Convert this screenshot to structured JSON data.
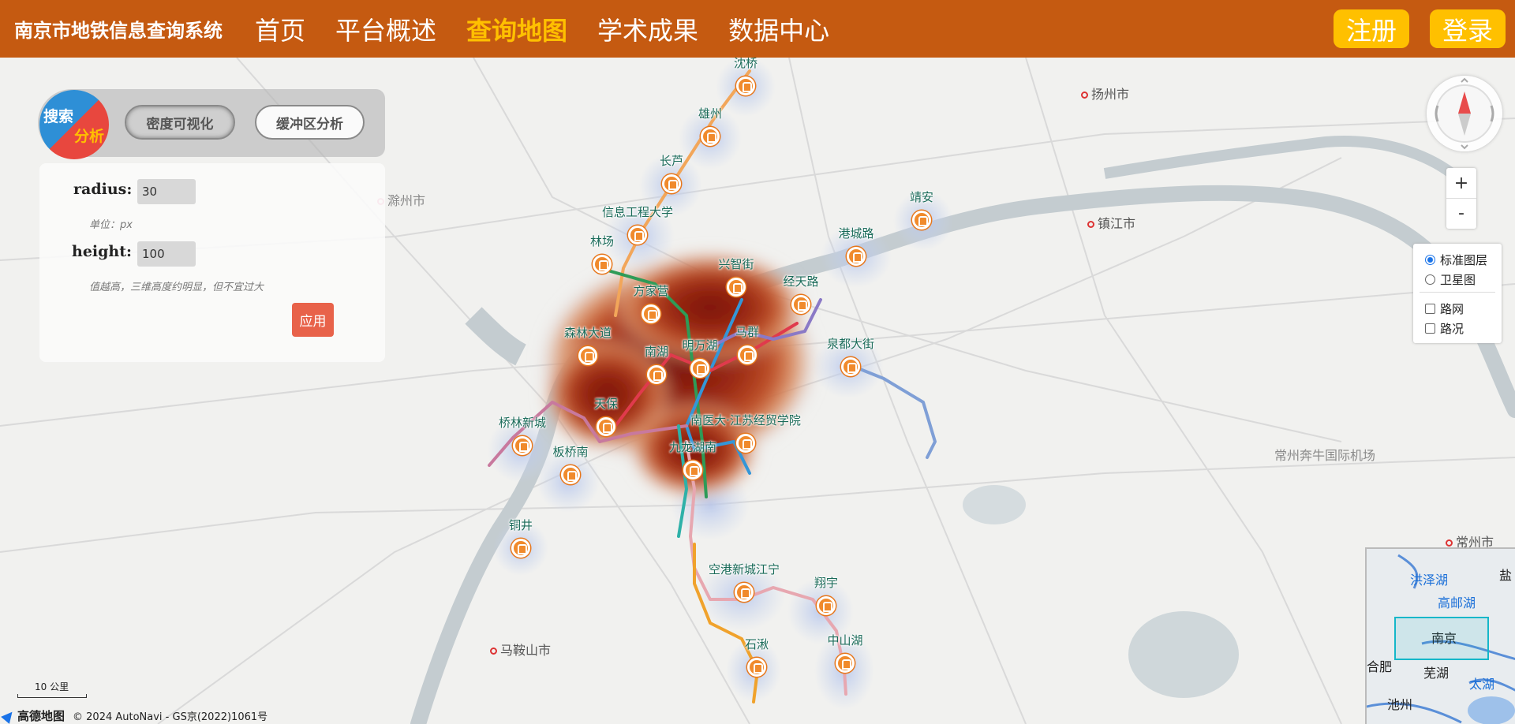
{
  "header": {
    "title": "南京市地铁信息查询系统",
    "nav": [
      {
        "label": "首页"
      },
      {
        "label": "平台概述"
      },
      {
        "label": "查询地图",
        "active": true
      },
      {
        "label": "学术成果"
      },
      {
        "label": "数据中心"
      }
    ],
    "register_label": "注册",
    "login_label": "登录",
    "accent_color": "#ffc000",
    "bar_color": "#c55a11"
  },
  "analysis": {
    "logo_search": "搜索",
    "logo_analyze": "分析",
    "tabs": [
      {
        "label": "密度可视化",
        "active": true
      },
      {
        "label": "缓冲区分析",
        "active": false
      }
    ],
    "radius_label": "radius:",
    "radius_value": "30",
    "radius_unit": "单位：px",
    "height_label": "height:",
    "height_value": "100",
    "height_hint": "值越高，三维高度约明显，但不宜过大",
    "apply_label": "应用"
  },
  "map": {
    "cities": [
      "扬州市",
      "滁州市",
      "镇江市",
      "马鞍山市",
      "常州市",
      "常州奔牛国际机场"
    ],
    "stations": [
      "沈桥",
      "雄州",
      "长芦",
      "信息工程大学",
      "林场",
      "兴智街",
      "靖安",
      "港城路",
      "方家营",
      "经天路",
      "森林大道",
      "南湖",
      "明万湖",
      "马群",
      "泉都大街",
      "天保",
      "桥林新城",
      "南医大·江苏经贸学院",
      "板桥南",
      "九龙湖南",
      "铜井",
      "空港新城江宁",
      "翔宇",
      "石湫",
      "中山湖",
      "明觉"
    ],
    "station_color": "#f08a2c",
    "heat_color": "#8b1a10"
  },
  "layers": {
    "options": [
      {
        "label": "标准图层",
        "checked": true
      },
      {
        "label": "卫星图",
        "checked": false
      },
      {
        "label": "路网",
        "checked": false
      },
      {
        "label": "路况",
        "checked": false
      }
    ]
  },
  "zoom": {
    "in_label": "+",
    "out_label": "-"
  },
  "overview": {
    "labels": [
      "洪泽湖",
      "高邮湖",
      "南京",
      "合肥",
      "芜湖",
      "太湖",
      "池州",
      "盐"
    ]
  },
  "footer": {
    "scale_label": "10 公里",
    "brand": "高德地图",
    "copyright": "© 2024 AutoNavi - GS京(2022)1061号"
  }
}
